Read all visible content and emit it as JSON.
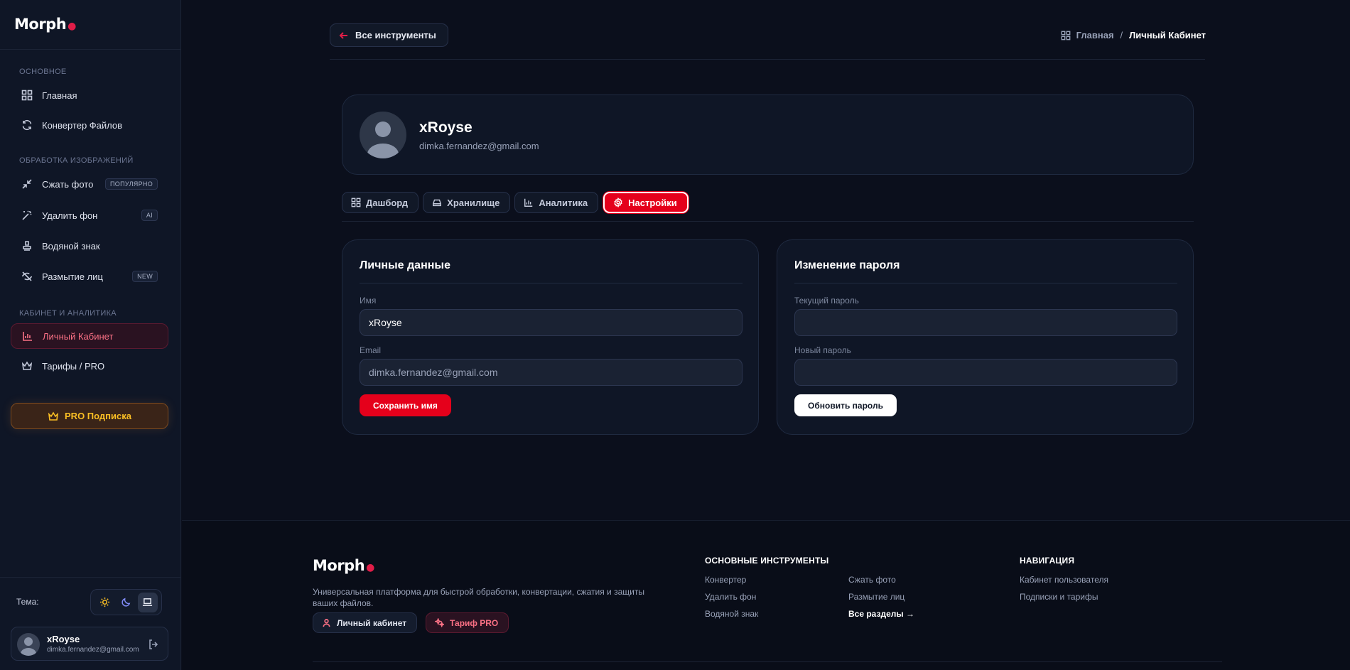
{
  "brand": {
    "name": "Morph",
    "accent": "#e11d48"
  },
  "sidebar": {
    "sections": [
      {
        "label": "ОСНОВНОЕ"
      },
      {
        "label": "ОБРАБОТКА ИЗОБРАЖЕНИЙ"
      },
      {
        "label": "КАБИНЕТ И АНАЛИТИКА"
      }
    ],
    "items": [
      {
        "label": "Главная",
        "icon": "grid-icon"
      },
      {
        "label": "Конвертер Файлов",
        "icon": "refresh-icon"
      },
      {
        "label": "Сжать фото",
        "icon": "compress-icon",
        "badge": "ПОПУЛЯРНО"
      },
      {
        "label": "Удалить фон",
        "icon": "magic-wand-icon",
        "badge": "AI"
      },
      {
        "label": "Водяной знак",
        "icon": "stamp-icon"
      },
      {
        "label": "Размытие лиц",
        "icon": "eye-off-icon",
        "badge": "NEW"
      },
      {
        "label": "Личный Кабинет",
        "icon": "bar-chart-icon",
        "active": true
      },
      {
        "label": "Тарифы / PRO",
        "icon": "crown-icon"
      }
    ],
    "pro_button": "PRO Подписка",
    "theme_label": "Тема:",
    "theme_selected": "system",
    "user": {
      "name": "xRoyse",
      "email": "dimka.fernandez@gmail.com"
    }
  },
  "header": {
    "back_label": "Все инструменты",
    "breadcrumb": {
      "home": "Главная",
      "separator": "/",
      "current": "Личный Кабинет"
    }
  },
  "profile": {
    "name": "xRoyse",
    "email": "dimka.fernandez@gmail.com"
  },
  "tabs": [
    {
      "label": "Дашборд",
      "icon": "grid-icon"
    },
    {
      "label": "Хранилище",
      "icon": "drive-icon"
    },
    {
      "label": "Аналитика",
      "icon": "bar-chart-icon"
    },
    {
      "label": "Настройки",
      "icon": "gear-icon",
      "active": true
    }
  ],
  "personal": {
    "title": "Личные данные",
    "name_label": "Имя",
    "name_value": "xRoyse",
    "email_label": "Email",
    "email_value": "dimka.fernandez@gmail.com",
    "save_label": "Сохранить имя"
  },
  "password": {
    "title": "Изменение пароля",
    "current_label": "Текущий пароль",
    "current_value": "",
    "new_label": "Новый пароль",
    "new_value": "",
    "update_label": "Обновить пароль"
  },
  "footer": {
    "brand": "Morph",
    "description": "Универсальная платформа для быстрой обработки, конвертации, сжатия и защиты ваших файлов.",
    "account_link": "Личный кабинет",
    "pro_link": "Тариф PRO",
    "tools_heading": "ОСНОВНЫЕ ИНСТРУМЕНТЫ",
    "tools_col1": [
      "Конвертер",
      "Удалить фон",
      "Водяной знак"
    ],
    "tools_col2": [
      "Сжать фото",
      "Размытие лиц",
      "Все разделы →"
    ],
    "nav_heading": "НАВИГАЦИЯ",
    "nav_links": [
      "Кабинет пользователя",
      "Подписки и тарифы"
    ]
  }
}
